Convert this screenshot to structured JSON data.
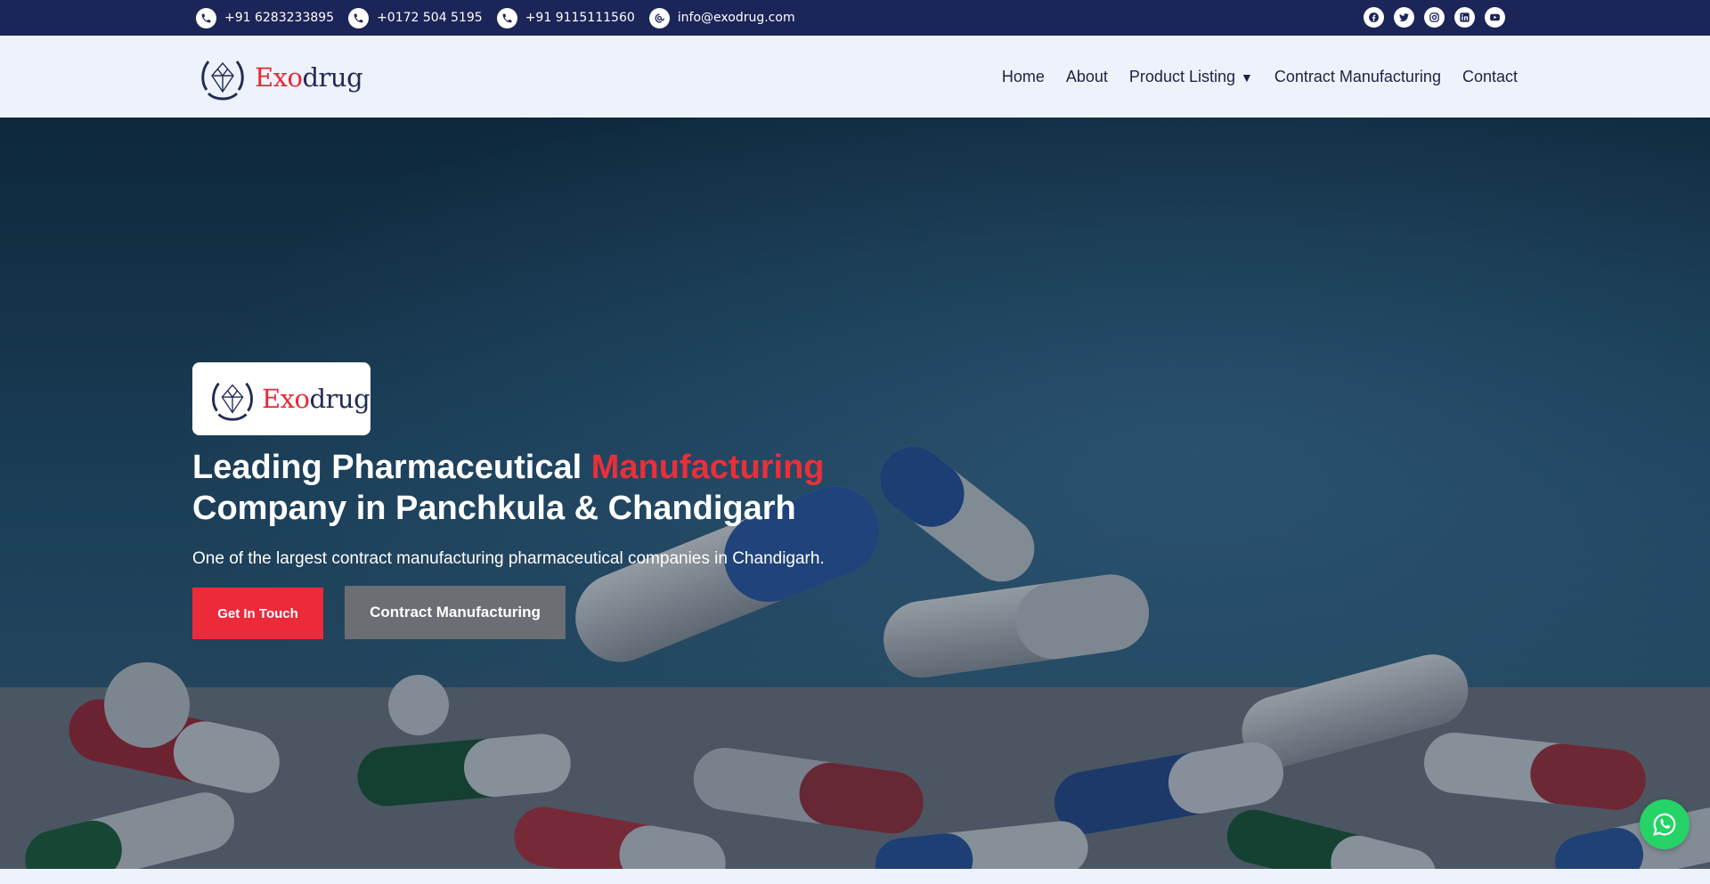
{
  "topbar": {
    "contacts": [
      {
        "icon": "phone-icon",
        "text": "+91 6283233895"
      },
      {
        "icon": "phone-icon",
        "text": "+0172 504 5195"
      },
      {
        "icon": "phone-icon",
        "text": "+91 9115111560"
      },
      {
        "icon": "email-icon",
        "text": "info@exodrug.com"
      }
    ],
    "social": [
      "facebook-icon",
      "twitter-icon",
      "instagram-icon",
      "linkedin-icon",
      "youtube-icon"
    ],
    "bg_color": "#1b2557"
  },
  "logo": {
    "part1": "Exo",
    "part2": "drug",
    "accent": "#e62a36",
    "dark": "#222b55"
  },
  "nav": {
    "items": [
      "Home",
      "About",
      "Product Listing",
      "Contract Manufacturing",
      "Contact"
    ],
    "dropdown_caret": "▼"
  },
  "hero": {
    "title_part1": "Leading Pharmaceutical ",
    "title_highlight": "Manufacturing",
    "title_part2": "Company in Panchkula & Chandigarh",
    "subtitle": "One of the largest contract manufacturing pharmaceutical companies in Chandigarh.",
    "btn_primary": "Get In Touch",
    "btn_secondary": "Contract Manufacturing",
    "highlight_color": "#e8303a"
  },
  "whatsapp": {
    "icon": "whatsapp-icon",
    "color": "#25d366"
  }
}
